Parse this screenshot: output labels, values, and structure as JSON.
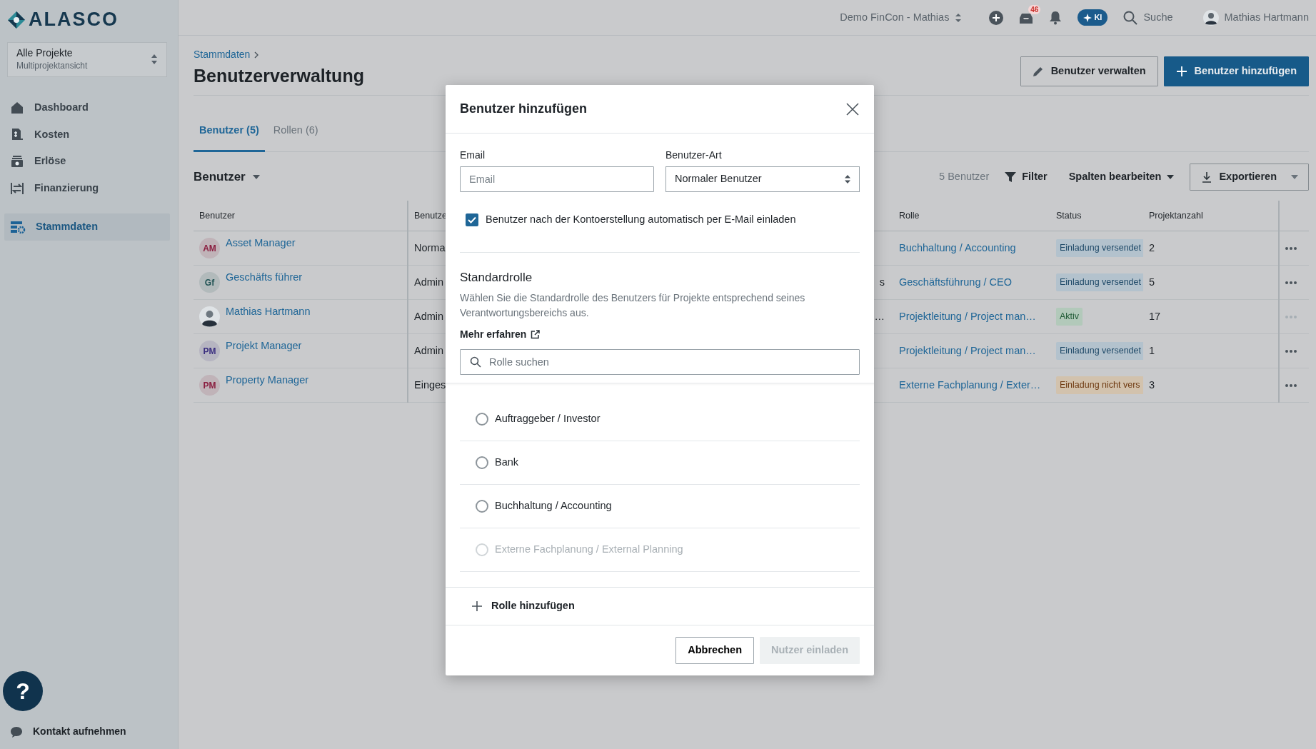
{
  "sidebar": {
    "logo": "ALASCO",
    "project_switcher": {
      "title": "Alle Projekte",
      "subtitle": "Multiprojektansicht"
    },
    "nav": [
      {
        "label": "Dashboard",
        "selected": false
      },
      {
        "label": "Kosten",
        "selected": false
      },
      {
        "label": "Erlöse",
        "selected": false
      },
      {
        "label": "Finanzierung",
        "selected": false
      }
    ],
    "settings_nav": [
      {
        "label": "Stammdaten",
        "selected": true
      }
    ],
    "help": "?",
    "contact": "Kontakt aufnehmen"
  },
  "topbar": {
    "workspace": "Demo FinCon - Mathias",
    "inbox_badge": "46",
    "ai_label": "KI",
    "search": "Suche",
    "user": "Mathias Hartmann"
  },
  "page": {
    "breadcrumb": "Stammdaten",
    "title": "Benutzerverwaltung",
    "actions": [
      "Benutzer verwalten",
      "Benutzer hinzufügen"
    ],
    "tabs": [
      {
        "label": "Benutzer (5)",
        "selected": true
      },
      {
        "label": "Rollen (6)",
        "selected": false
      }
    ],
    "view": "Benutzer",
    "count": "5 Benutzer",
    "filter": "Filter",
    "columns_menu": "Spalten bearbeiten",
    "export": "Exportieren"
  },
  "table": {
    "columns": [
      "Benutzer",
      "Benutze",
      "Rolle",
      "Status",
      "Projektanzahl"
    ],
    "rows": [
      {
        "avatar": {
          "kind": "initials",
          "initials": "AM",
          "color": "#8a1d3f"
        },
        "name": "Asset Manager",
        "type": "Norma",
        "role": "Buchhaltung / Accounting",
        "status": {
          "label": "Einladung versendet",
          "kind": "sent"
        },
        "projects": "2",
        "menu_disabled": false
      },
      {
        "avatar": {
          "kind": "initials",
          "initials": "Gf",
          "color": "#1f5253"
        },
        "name": "Geschäfts führer",
        "type": "Admin",
        "column_3": "s",
        "role": "Geschäftsführung / CEO",
        "status": {
          "label": "Einladung versendet",
          "kind": "sent"
        },
        "projects": "5",
        "menu_disabled": false
      },
      {
        "avatar": {
          "kind": "photo"
        },
        "name": "Mathias Hartmann",
        "type": "Admin",
        "column_3": "…",
        "role": "Projektleitung / Project man…",
        "status": {
          "label": "Aktiv",
          "kind": "active"
        },
        "projects": "17",
        "menu_disabled": true
      },
      {
        "avatar": {
          "kind": "initials",
          "initials": "PM",
          "color": "#3b2f80"
        },
        "name": "Projekt Manager",
        "type": "Admin",
        "role": "Projektleitung / Project man…",
        "status": {
          "label": "Einladung versendet",
          "kind": "sent"
        },
        "projects": "1",
        "menu_disabled": false
      },
      {
        "avatar": {
          "kind": "initials",
          "initials": "PM",
          "color": "#8a1d3f"
        },
        "name": "Property Manager",
        "type": "Einges",
        "role": "Externe Fachplanung / Exter…",
        "status": {
          "label": "Einladung nicht vers",
          "kind": "not_sent"
        },
        "projects": "3",
        "menu_disabled": false
      }
    ]
  },
  "modal": {
    "title": "Benutzer hinzufügen",
    "email": {
      "label": "Email",
      "placeholder": "Email"
    },
    "user_type": {
      "label": "Benutzer-Art",
      "value": "Normaler Benutzer"
    },
    "invite": {
      "label": "Benutzer nach der Kontoerstellung automatisch per E-Mail einladen",
      "checked": true
    },
    "section_title": "Standardrolle",
    "section_text": "Wählen Sie die Standardrolle des Benutzers für Projekte entsprechend seines Verantwortungsbereichs aus.",
    "learn_more": "Mehr erfahren",
    "role_search": {
      "placeholder": "Rolle suchen"
    },
    "roles": [
      {
        "label": "Auftraggeber / Investor",
        "selected": false,
        "disabled": false
      },
      {
        "label": "Bank",
        "selected": false,
        "disabled": false
      },
      {
        "label": "Buchhaltung / Accounting",
        "selected": false,
        "disabled": false
      },
      {
        "label": "Externe Fachplanung / External Planning",
        "selected": false,
        "disabled": true
      }
    ],
    "add_role": "Rolle hinzufügen",
    "cancel": "Abbrechen",
    "submit": {
      "label": "Nutzer einladen",
      "disabled": true
    }
  }
}
